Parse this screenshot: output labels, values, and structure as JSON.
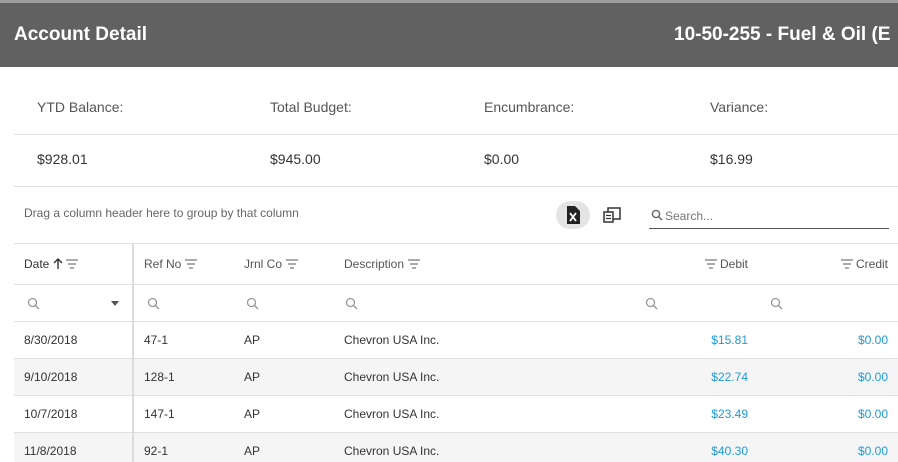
{
  "header": {
    "title": "Account Detail",
    "account": "10-50-255 - Fuel & Oil (E"
  },
  "summary": [
    {
      "label": "YTD Balance:",
      "value": "$928.01"
    },
    {
      "label": "Total Budget:",
      "value": "$945.00"
    },
    {
      "label": "Encumbrance:",
      "value": "$0.00"
    },
    {
      "label": "Variance:",
      "value": "$16.99"
    }
  ],
  "toolbar": {
    "group_hint": "Drag a column header here to group by that column",
    "search_placeholder": "Search...",
    "export_icon": "excel-export-icon",
    "column_chooser_icon": "column-chooser-icon"
  },
  "grid": {
    "columns": [
      "Date",
      "Ref No",
      "Jrnl Co",
      "Description",
      "Debit",
      "Credit"
    ],
    "sort": {
      "column": "Date",
      "direction": "ascending"
    },
    "rows": [
      {
        "date": "8/30/2018",
        "ref": "47-1",
        "jrnl": "AP",
        "desc": "Chevron USA Inc.",
        "debit": "$15.81",
        "credit": "$0.00"
      },
      {
        "date": "9/10/2018",
        "ref": "128-1",
        "jrnl": "AP",
        "desc": "Chevron USA Inc.",
        "debit": "$22.74",
        "credit": "$0.00"
      },
      {
        "date": "10/7/2018",
        "ref": "147-1",
        "jrnl": "AP",
        "desc": "Chevron USA Inc.",
        "debit": "$23.49",
        "credit": "$0.00"
      },
      {
        "date": "11/8/2018",
        "ref": "92-1",
        "jrnl": "AP",
        "desc": "Chevron USA Inc.",
        "debit": "$40.30",
        "credit": "$0.00"
      }
    ]
  },
  "colors": {
    "header_bg": "#616161",
    "amount": "#1e9bd7",
    "alt_row": "#f5f5f5"
  }
}
